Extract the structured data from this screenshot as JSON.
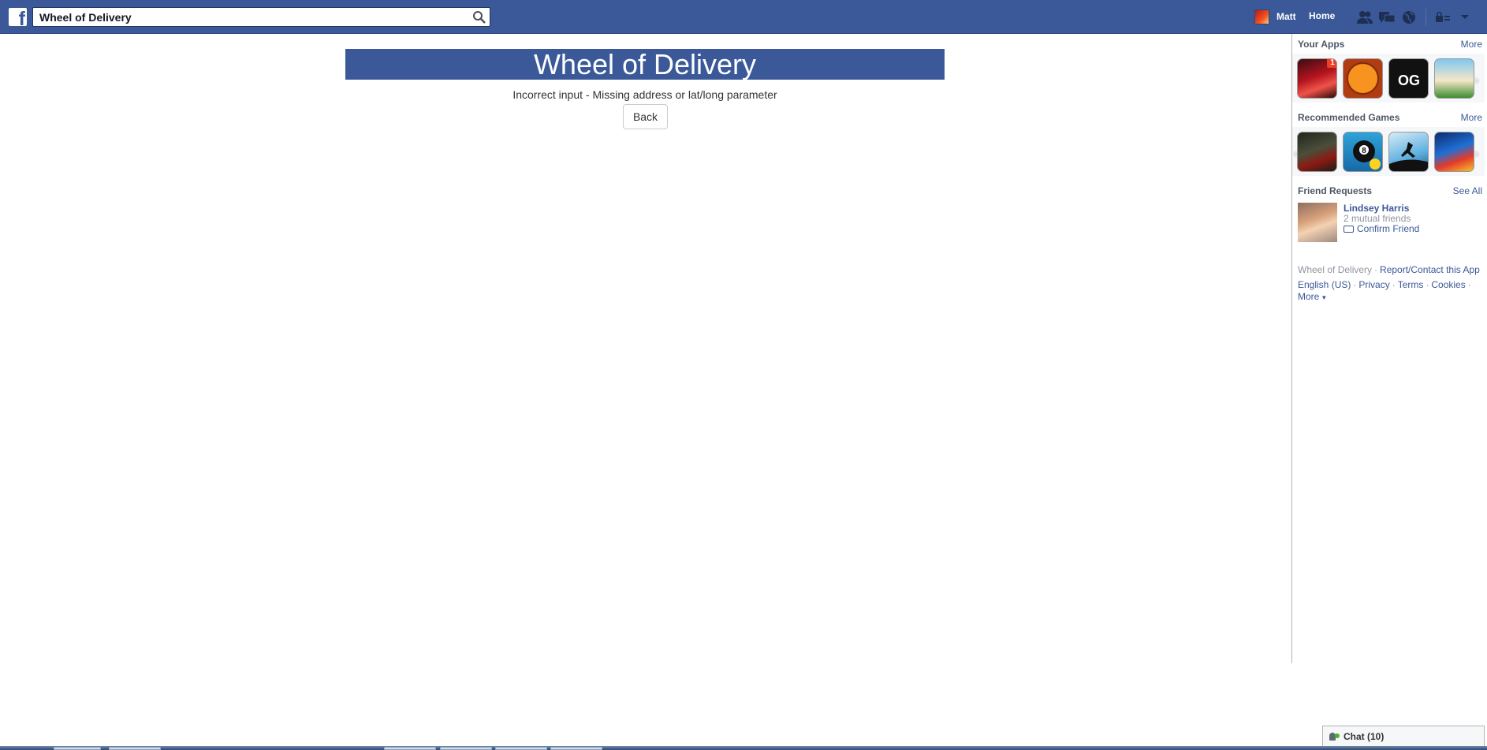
{
  "topbar": {
    "search_value": "Wheel of Delivery",
    "user_name": "Matt",
    "home_label": "Home",
    "brand_color": "#3b5998"
  },
  "main": {
    "app_title": "Wheel of Delivery",
    "message": "Incorrect input - Missing address or lat/long parameter",
    "back_label": "Back"
  },
  "sidebar": {
    "your_apps": {
      "title": "Your Apps",
      "more": "More",
      "apps": [
        {
          "name": "poker-app-icon",
          "badge": "1"
        },
        {
          "name": "basketball-app-icon"
        },
        {
          "name": "og-war-app-icon"
        },
        {
          "name": "farm-cow-app-icon"
        }
      ]
    },
    "recommended": {
      "title": "Recommended Games",
      "more": "More",
      "games": [
        {
          "name": "soldier-game-icon"
        },
        {
          "name": "pool-8-ball-game-icon"
        },
        {
          "name": "runner-game-icon"
        },
        {
          "name": "street-race-game-icon"
        }
      ]
    },
    "friend_requests": {
      "title": "Friend Requests",
      "see_all": "See All",
      "name": "Lindsey Harris",
      "mutual": "2 mutual friends",
      "confirm": "Confirm Friend"
    },
    "footer": {
      "app_name": "Wheel of Delivery",
      "report": "Report/Contact this App",
      "language": "English (US)",
      "privacy": "Privacy",
      "terms": "Terms",
      "cookies": "Cookies",
      "more": "More"
    }
  },
  "chat": {
    "label": "Chat (10)"
  }
}
